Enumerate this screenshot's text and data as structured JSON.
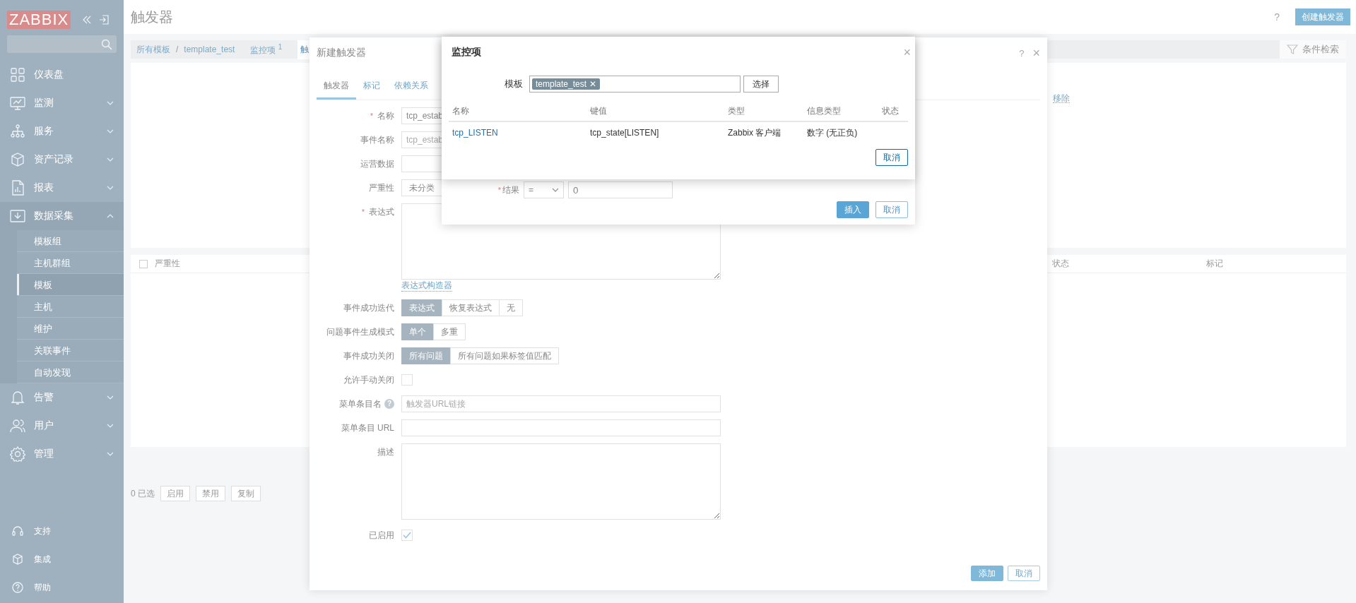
{
  "sidebar": {
    "logo": "ZABBIX",
    "menu": [
      {
        "kind": "link",
        "label": "仪表盘"
      },
      {
        "kind": "group",
        "label": "监测",
        "expanded": false
      },
      {
        "kind": "group",
        "label": "服务",
        "expanded": false
      },
      {
        "kind": "group",
        "label": "资产记录",
        "expanded": false
      },
      {
        "kind": "group",
        "label": "报表",
        "expanded": false
      },
      {
        "kind": "group",
        "label": "数据采集",
        "expanded": true,
        "children": [
          {
            "label": "模板组",
            "selected": false
          },
          {
            "label": "主机群组",
            "selected": false
          },
          {
            "label": "模板",
            "selected": true
          },
          {
            "label": "主机",
            "selected": false
          },
          {
            "label": "维护",
            "selected": false
          },
          {
            "label": "关联事件",
            "selected": false
          },
          {
            "label": "自动发现",
            "selected": false
          }
        ]
      },
      {
        "kind": "group",
        "label": "告警",
        "expanded": false
      },
      {
        "kind": "group",
        "label": "用户",
        "expanded": false
      },
      {
        "kind": "group",
        "label": "管理",
        "expanded": false
      }
    ],
    "footer": [
      {
        "label": "支持"
      },
      {
        "label": "集成"
      },
      {
        "label": "帮助"
      }
    ]
  },
  "page": {
    "title": "触发器",
    "help": "?",
    "create_button": "创建触发器",
    "breadcrumb": {
      "items": [
        "所有模板",
        "template_test"
      ],
      "separator": "/"
    },
    "tabs": [
      {
        "label": "监控项",
        "count": "1",
        "selected": false
      },
      {
        "label": "触",
        "selected": true
      }
    ],
    "filter_tab": "条件检索",
    "remove_link": "移除",
    "table": {
      "select_all": {
        "checked": false
      },
      "columns": [
        "严重性",
        "状态",
        "标记"
      ]
    },
    "selected_count": "0 已选",
    "mass_buttons": [
      "启用",
      "禁用",
      "复制"
    ]
  },
  "trigger_dialog": {
    "title": "新建触发器",
    "help": "?",
    "close": "×",
    "required_mark": "*",
    "tabs": [
      {
        "label": "触发器",
        "selected": true
      },
      {
        "label": "标记",
        "selected": false
      },
      {
        "label": "依赖关系",
        "selected": false
      }
    ],
    "rows": [
      {
        "kind": "input",
        "label": "名称",
        "required": true,
        "value": "tcp_estab"
      },
      {
        "kind": "input",
        "label": "事件名称",
        "placeholder": "tcp_estab"
      },
      {
        "kind": "input",
        "label": "运营数据"
      },
      {
        "kind": "segmented",
        "label": "严重性",
        "options": [
          {
            "label": "未分类",
            "selected": false
          }
        ]
      },
      {
        "kind": "textarea",
        "label": "表达式",
        "required": true
      },
      {
        "kind": "link",
        "text": "表达式构造器"
      },
      {
        "kind": "segmented",
        "label": "事件成功迭代",
        "options": [
          {
            "label": "表达式",
            "selected": true
          },
          {
            "label": "恢复表达式",
            "selected": false
          },
          {
            "label": "无",
            "selected": false
          }
        ]
      },
      {
        "kind": "segmented",
        "label": "问题事件生成模式",
        "options": [
          {
            "label": "单个",
            "selected": true
          },
          {
            "label": "多重",
            "selected": false
          }
        ]
      },
      {
        "kind": "segmented",
        "label": "事件成功关闭",
        "options": [
          {
            "label": "所有问题",
            "selected": true
          },
          {
            "label": "所有问题如果标签值匹配",
            "selected": false
          }
        ]
      },
      {
        "kind": "checkbox",
        "label": "允许手动关闭",
        "checked": false
      },
      {
        "kind": "input",
        "label": "菜单条目名",
        "help": "?",
        "placeholder": "触发器URL链接"
      },
      {
        "kind": "input",
        "label": "菜单条目 URL"
      },
      {
        "kind": "textarea",
        "label": "描述"
      },
      {
        "kind": "checkbox",
        "label": "已启用",
        "checked": true
      }
    ],
    "buttons": [
      {
        "kind": "primary",
        "label": "添加"
      },
      {
        "kind": "secondary",
        "label": "取消"
      }
    ]
  },
  "condition_dialog": {
    "required_mark": "*",
    "result": {
      "label": "结果",
      "required": true,
      "operator": "=",
      "value": "0"
    },
    "buttons": [
      {
        "kind": "primary",
        "label": "插入"
      },
      {
        "kind": "secondary",
        "label": "取消"
      }
    ]
  },
  "item_popup": {
    "title": "监控项",
    "close": "×",
    "template": {
      "label": "模板",
      "tags": [
        "template_test"
      ],
      "remove": "✕",
      "select_button": "选择"
    },
    "table": {
      "columns": [
        "名称",
        "键值",
        "类型",
        "信息类型",
        "状态"
      ],
      "rows": [
        {
          "name": "tcp_LISTEN",
          "key": "tcp_state[LISTEN]",
          "type": "Zabbix 客户端",
          "info_type": "数字 (无正负)"
        }
      ]
    },
    "buttons": [
      {
        "kind": "secondary",
        "label": "取消"
      }
    ]
  }
}
